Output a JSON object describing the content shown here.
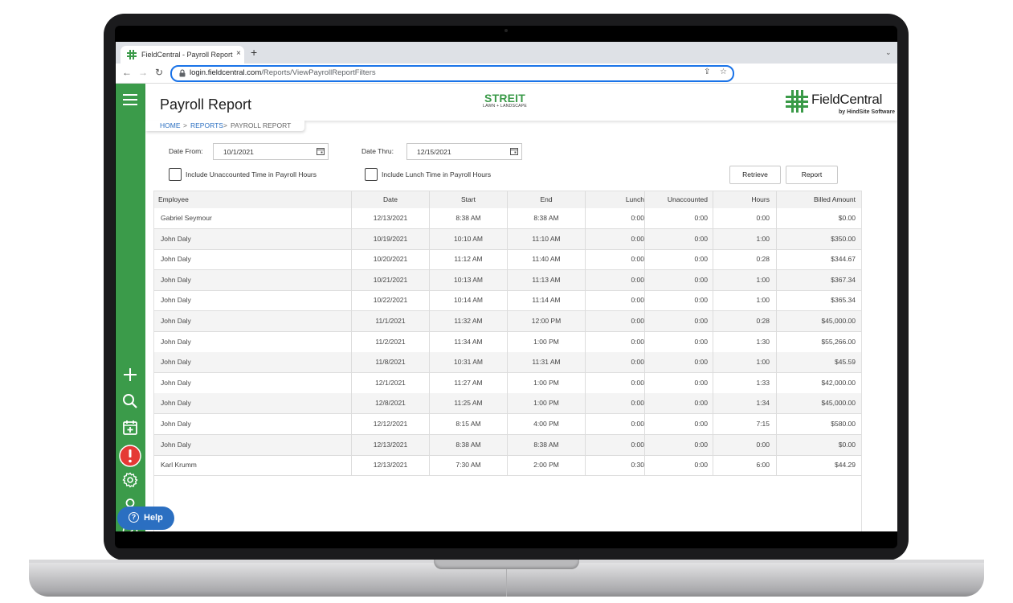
{
  "browser": {
    "tab_title": "FieldCentral - Payroll Report",
    "tab_close": "×",
    "new_tab": "+",
    "url_host": "login.fieldcentral.com",
    "url_path": "/Reports/ViewPayrollReportFilters"
  },
  "header": {
    "title": "Payroll Report",
    "client_logo_main": "STREIT",
    "client_logo_sub": "LAWN + LANDSCAPE",
    "brand_name": "FieldCentral",
    "brand_by": "by HindSite Software"
  },
  "breadcrumb": {
    "home": "HOME",
    "sep1": ">",
    "reports": "REPORTS",
    "sep2": ">",
    "current": "PAYROLL REPORT"
  },
  "filters": {
    "date_from_label": "Date From:",
    "date_from_value": "10/1/2021",
    "date_thru_label": "Date Thru:",
    "date_thru_value": "12/15/2021",
    "include_unaccounted_label": "Include Unaccounted Time in Payroll Hours",
    "include_unaccounted_checked": false,
    "include_lunch_label": "Include Lunch Time in Payroll Hours",
    "include_lunch_checked": false,
    "retrieve_label": "Retrieve",
    "report_label": "Report"
  },
  "table": {
    "columns": [
      "Employee",
      "Date",
      "Start",
      "End",
      "Lunch",
      "Unaccounted",
      "Hours",
      "Billed Amount"
    ],
    "rows": [
      [
        "Gabriel Seymour",
        "12/13/2021",
        "8:38 AM",
        "8:38 AM",
        "0:00",
        "0:00",
        "0:00",
        "$0.00"
      ],
      [
        "John Daly",
        "10/19/2021",
        "10:10 AM",
        "11:10 AM",
        "0:00",
        "0:00",
        "1:00",
        "$350.00"
      ],
      [
        "John Daly",
        "10/20/2021",
        "11:12 AM",
        "11:40 AM",
        "0:00",
        "0:00",
        "0:28",
        "$344.67"
      ],
      [
        "John Daly",
        "10/21/2021",
        "10:13 AM",
        "11:13 AM",
        "0:00",
        "0:00",
        "1:00",
        "$367.34"
      ],
      [
        "John Daly",
        "10/22/2021",
        "10:14 AM",
        "11:14 AM",
        "0:00",
        "0:00",
        "1:00",
        "$365.34"
      ],
      [
        "John Daly",
        "11/1/2021",
        "11:32 AM",
        "12:00 PM",
        "0:00",
        "0:00",
        "0:28",
        "$45,000.00"
      ],
      [
        "John Daly",
        "11/2/2021",
        "11:34 AM",
        "1:00 PM",
        "0:00",
        "0:00",
        "1:30",
        "$55,266.00"
      ],
      [
        "John Daly",
        "11/8/2021",
        "10:31 AM",
        "11:31 AM",
        "0:00",
        "0:00",
        "1:00",
        "$45.59"
      ],
      [
        "John Daly",
        "12/1/2021",
        "11:27 AM",
        "1:00 PM",
        "0:00",
        "0:00",
        "1:33",
        "$42,000.00"
      ],
      [
        "John Daly",
        "12/8/2021",
        "11:25 AM",
        "1:00 PM",
        "0:00",
        "0:00",
        "1:34",
        "$45,000.00"
      ],
      [
        "John Daly",
        "12/12/2021",
        "8:15 AM",
        "4:00 PM",
        "0:00",
        "0:00",
        "7:15",
        "$580.00"
      ],
      [
        "John Daly",
        "12/13/2021",
        "8:38 AM",
        "8:38 AM",
        "0:00",
        "0:00",
        "0:00",
        "$0.00"
      ],
      [
        "Karl Krumm",
        "12/13/2021",
        "7:30 AM",
        "2:00 PM",
        "0:30",
        "0:00",
        "6:00",
        "$44.29"
      ]
    ]
  },
  "sidebar": {
    "icons": [
      "menu-icon",
      "add-icon",
      "search-icon",
      "calendar-add-icon",
      "alert-icon",
      "settings-icon",
      "user-icon",
      "help-circle-icon"
    ],
    "alert_color": "#e53935"
  },
  "help": {
    "label": "Help"
  },
  "colors": {
    "sidebar": "#3b9b4a",
    "accent_blue": "#2b6fc1",
    "brand_green": "#3a9a48"
  }
}
